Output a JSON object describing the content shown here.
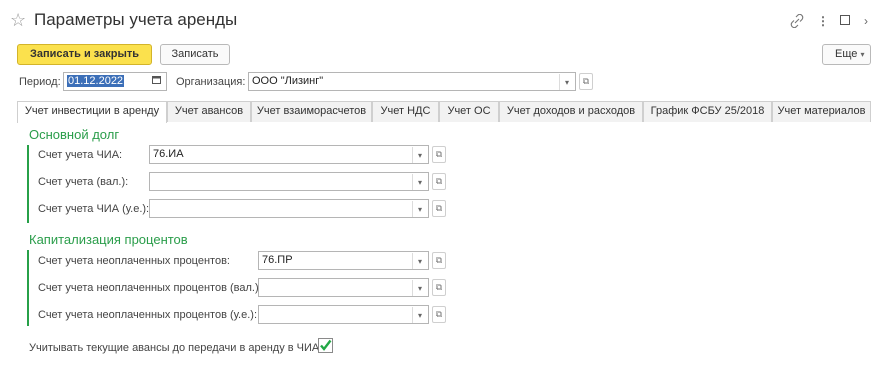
{
  "window": {
    "title": "Параметры учета аренды",
    "star_icon": "star-icon",
    "link_icon": "link-icon",
    "menu_icon": "more-vertical-icon",
    "maximize_icon": "maximize-icon",
    "close_icon": "close-icon"
  },
  "toolbar": {
    "save_close_label": "Записать и закрыть",
    "save_label": "Записать",
    "more_label": "Еще",
    "more_arrow": "▾"
  },
  "period": {
    "label": "Период:",
    "value": "01.12.2022"
  },
  "organization": {
    "label": "Организация:",
    "value": "ООО \"Лизинг\""
  },
  "tabs": [
    {
      "label": "Учет инвестиции в аренду",
      "active": true
    },
    {
      "label": "Учет авансов"
    },
    {
      "label": "Учет взаиморасчетов"
    },
    {
      "label": "Учет НДС"
    },
    {
      "label": "Учет ОС"
    },
    {
      "label": "Учет доходов и расходов"
    },
    {
      "label": "График ФСБУ 25/2018"
    },
    {
      "label": "Учет материалов"
    }
  ],
  "main_debt": {
    "title": "Основной долг",
    "fields": [
      {
        "label": "Счет учета ЧИА:",
        "value": "76.ИА"
      },
      {
        "label": "Счет учета (вал.):",
        "value": ""
      },
      {
        "label": "Счет учета ЧИА (у.е.):",
        "value": ""
      }
    ]
  },
  "interest": {
    "title": "Капитализация процентов",
    "fields": [
      {
        "label": "Счет учета неоплаченных процентов:",
        "value": "76.ПР"
      },
      {
        "label": "Счет учета неоплаченных процентов (вал.):",
        "value": ""
      },
      {
        "label": "Счет учета неоплаченных процентов (у.е.):",
        "value": ""
      }
    ]
  },
  "advances_option": {
    "label": "Учитывать текущие авансы до передачи в аренду в ЧИА:",
    "checked": true
  },
  "colors": {
    "accent_green": "#2a9d4a",
    "primary_yellow": "#fbe14d",
    "selection_blue": "#3c6fb8"
  }
}
